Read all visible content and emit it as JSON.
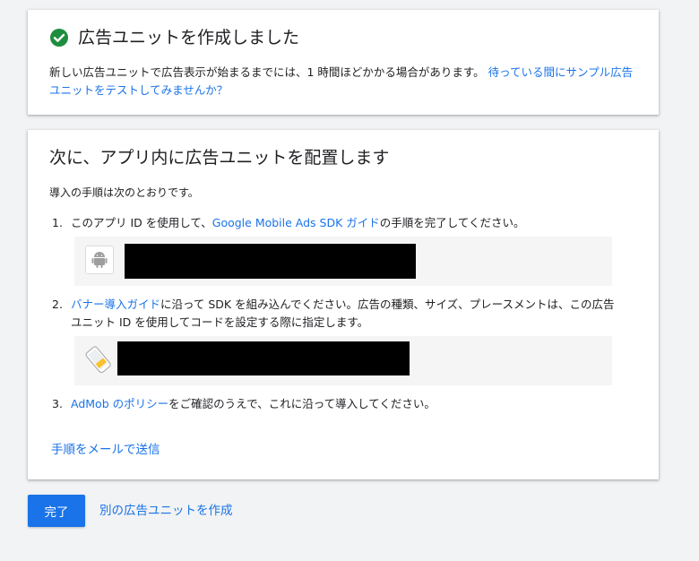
{
  "success_card": {
    "icon": "check-circle-icon",
    "title": "広告ユニットを作成しました",
    "message_prefix": "新しい広告ユニットで広告表示が始まるまでには、1 時間ほどかかる場合があります。",
    "message_link": "待っている間にサンプル広告ユニットをテストしてみませんか？"
  },
  "placement_card": {
    "title": "次に、アプリ内に広告ユニットを配置します",
    "intro": "導入の手順は次のとおりです。",
    "steps": [
      {
        "number": "1.",
        "prefix": "このアプリ ID を使用して、",
        "link": "Google Mobile Ads SDK ガイド",
        "suffix": "の手順を完了してください。",
        "icon": "android-icon"
      },
      {
        "number": "2.",
        "link": "バナー導入ガイド",
        "suffix": "に沿って SDK を組み込んでください。広告の種類、サイズ、プレースメントは、この広告ユニット ID を使用してコードを設定する際に指定します。",
        "icon": "banner-ad-icon"
      },
      {
        "number": "3.",
        "link": "AdMob のポリシー",
        "suffix": "をご確認のうえで、これに沿って導入してください。"
      }
    ],
    "email_link": "手順をメールで送信"
  },
  "actions": {
    "done_label": "完了",
    "create_another_label": "別の広告ユニットを作成"
  },
  "colors": {
    "accent": "#1a73e8",
    "success": "#1e8e3e",
    "background": "#f1f3f4"
  }
}
